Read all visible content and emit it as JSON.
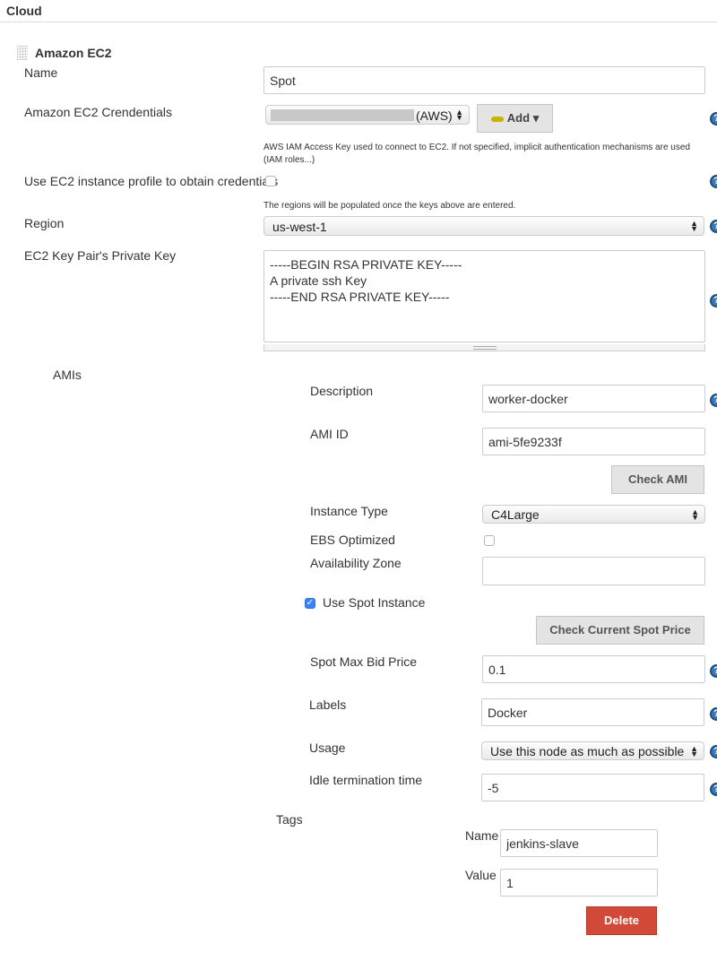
{
  "cloud": {
    "title": "Cloud"
  },
  "ec2": {
    "title": "Amazon EC2",
    "name_label": "Name",
    "name_value": "Spot",
    "cred_label": "Amazon EC2 Crendentials",
    "cred_value": "(AWS)",
    "add_label": "Add",
    "cred_help": "AWS IAM Access Key used to connect to EC2. If not specified, implicit authentication mechanisms are used (IAM roles...)",
    "profile_label": "Use EC2 instance profile to obtain credentials",
    "regions_note": "The regions will be populated once the keys above are entered.",
    "region_label": "Region",
    "region_value": "us-west-1",
    "key_label": "EC2 Key Pair's Private Key",
    "key_value": "-----BEGIN RSA PRIVATE KEY-----\nA private ssh Key\n-----END RSA PRIVATE KEY-----"
  },
  "amis": {
    "label": "AMIs",
    "description_label": "Description",
    "description_value": "worker-docker",
    "ami_id_label": "AMI ID",
    "ami_id_value": "ami-5fe9233f",
    "check_ami_label": "Check AMI",
    "instance_type_label": "Instance Type",
    "instance_type_value": "C4Large",
    "ebs_label": "EBS Optimized",
    "az_label": "Availability Zone",
    "az_value": "",
    "spot_label": "Use Spot Instance",
    "spot_checked": true,
    "check_price_label": "Check Current Spot Price",
    "bid_label": "Spot Max Bid Price",
    "bid_value": "0.1",
    "labels_label": "Labels",
    "labels_value": "Docker",
    "usage_label": "Usage",
    "usage_value": "Use this node as much as possible",
    "idle_label": "Idle termination time",
    "idle_value": "-5"
  },
  "tags": {
    "label": "Tags",
    "name_label": "Name",
    "name_value": "jenkins-slave",
    "value_label": "Value",
    "value_value": "1",
    "delete_label": "Delete"
  },
  "icons": {
    "help": "help-icon",
    "key": "key-icon",
    "drag": "drag-handle-icon"
  },
  "colors": {
    "help_blue": "#3a79b5",
    "delete_red": "#d24939",
    "check_blue": "#3b82f6"
  }
}
